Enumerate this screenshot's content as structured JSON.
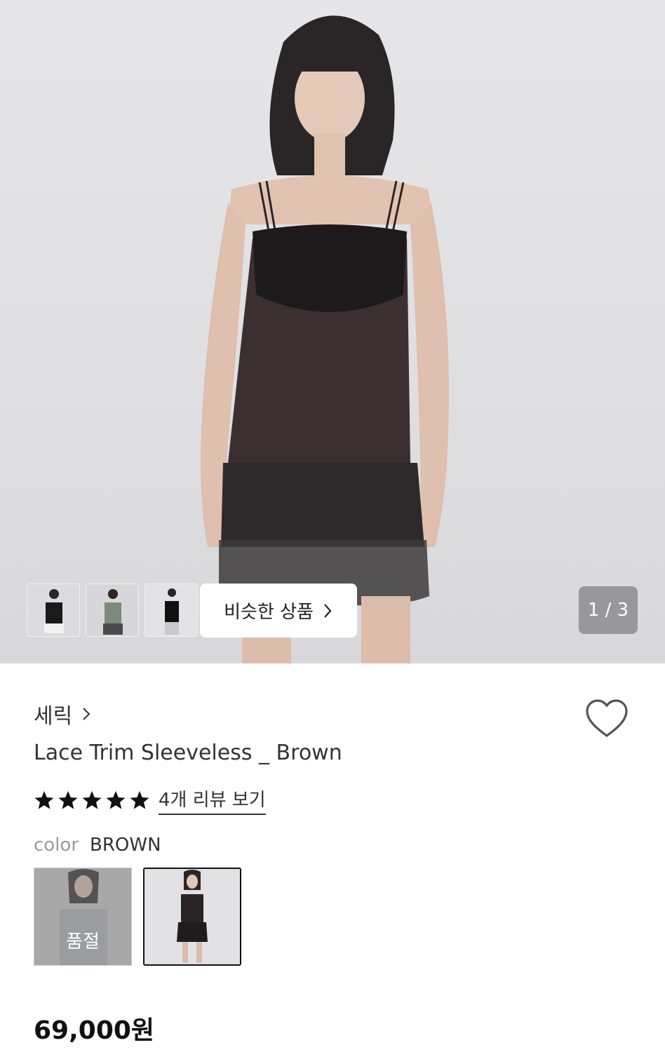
{
  "gallery": {
    "similar_label": "비슷한 상품",
    "counter": "1 / 3",
    "thumbnails": [
      "thumb-1",
      "thumb-2",
      "thumb-3"
    ]
  },
  "product": {
    "brand": "세릭",
    "title": "Lace Trim Sleeveless _ Brown",
    "rating": 5,
    "review_link": "4개 리뷰 보기",
    "color_label": "color",
    "color_value": "BROWN",
    "soldout_label": "품절",
    "price": "69,000원"
  },
  "icons": {
    "heart": "heart-icon",
    "star": "star-icon",
    "chevron": "chevron-right-icon"
  }
}
